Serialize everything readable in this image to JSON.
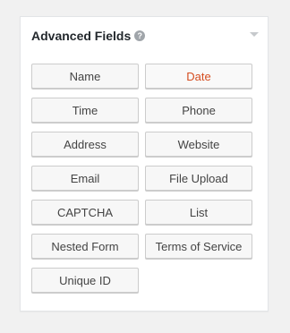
{
  "panel": {
    "title": "Advanced Fields",
    "help_icon": "question-circle-icon",
    "collapse_icon": "triangle-down-icon",
    "help_glyph": "?"
  },
  "fields": [
    {
      "label": "Name"
    },
    {
      "label": "Date",
      "highlighted": true
    },
    {
      "label": "Time"
    },
    {
      "label": "Phone"
    },
    {
      "label": "Address"
    },
    {
      "label": "Website"
    },
    {
      "label": "Email"
    },
    {
      "label": "File Upload"
    },
    {
      "label": "CAPTCHA"
    },
    {
      "label": "List"
    },
    {
      "label": "Nested Form"
    },
    {
      "label": "Terms of Service"
    },
    {
      "label": "Unique ID"
    }
  ],
  "colors": {
    "highlight_text": "#d54e21",
    "button_bg": "#f7f7f7",
    "button_border": "#cccccc"
  }
}
